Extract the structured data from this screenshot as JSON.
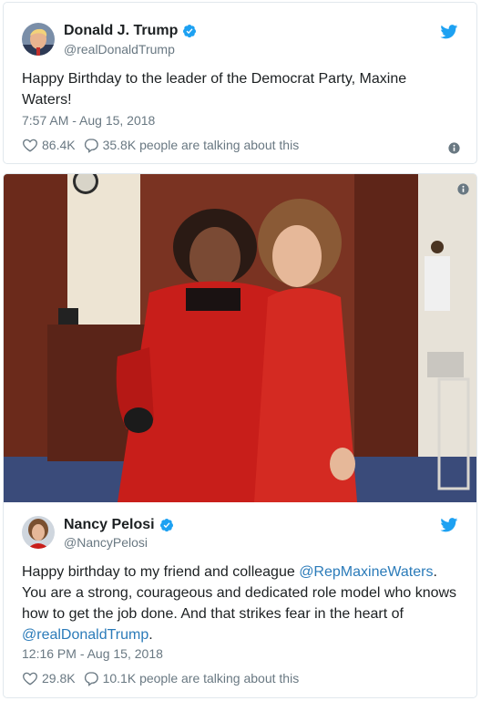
{
  "tweet1": {
    "display_name": "Donald J. Trump",
    "handle": "@realDonaldTrump",
    "text": "Happy Birthday to the leader of the Democrat Party, Maxine Waters!",
    "timestamp": "7:57 AM - Aug 15, 2018",
    "likes": "86.4K",
    "talking": "35.8K people are talking about this"
  },
  "tweet2": {
    "display_name": "Nancy Pelosi",
    "handle": "@NancyPelosi",
    "text_parts": {
      "p1": "Happy birthday to my friend and colleague ",
      "mention1": "@RepMaxineWaters",
      "p2": ". You are a strong, courageous and dedicated role model who knows how to get the job done. And that strikes fear in the heart of ",
      "mention2": "@realDonaldTrump",
      "p3": "."
    },
    "timestamp": "12:16 PM - Aug 15, 2018",
    "likes": "29.8K",
    "talking": "10.1K people are talking about this"
  },
  "colors": {
    "link": "#2b7bb9",
    "twitter_blue": "#1da1f2",
    "muted": "#697882",
    "border": "#e1e8ed"
  },
  "icons": [
    "verified-badge-icon",
    "twitter-bird-icon",
    "heart-icon",
    "reply-bubble-icon",
    "info-icon"
  ]
}
